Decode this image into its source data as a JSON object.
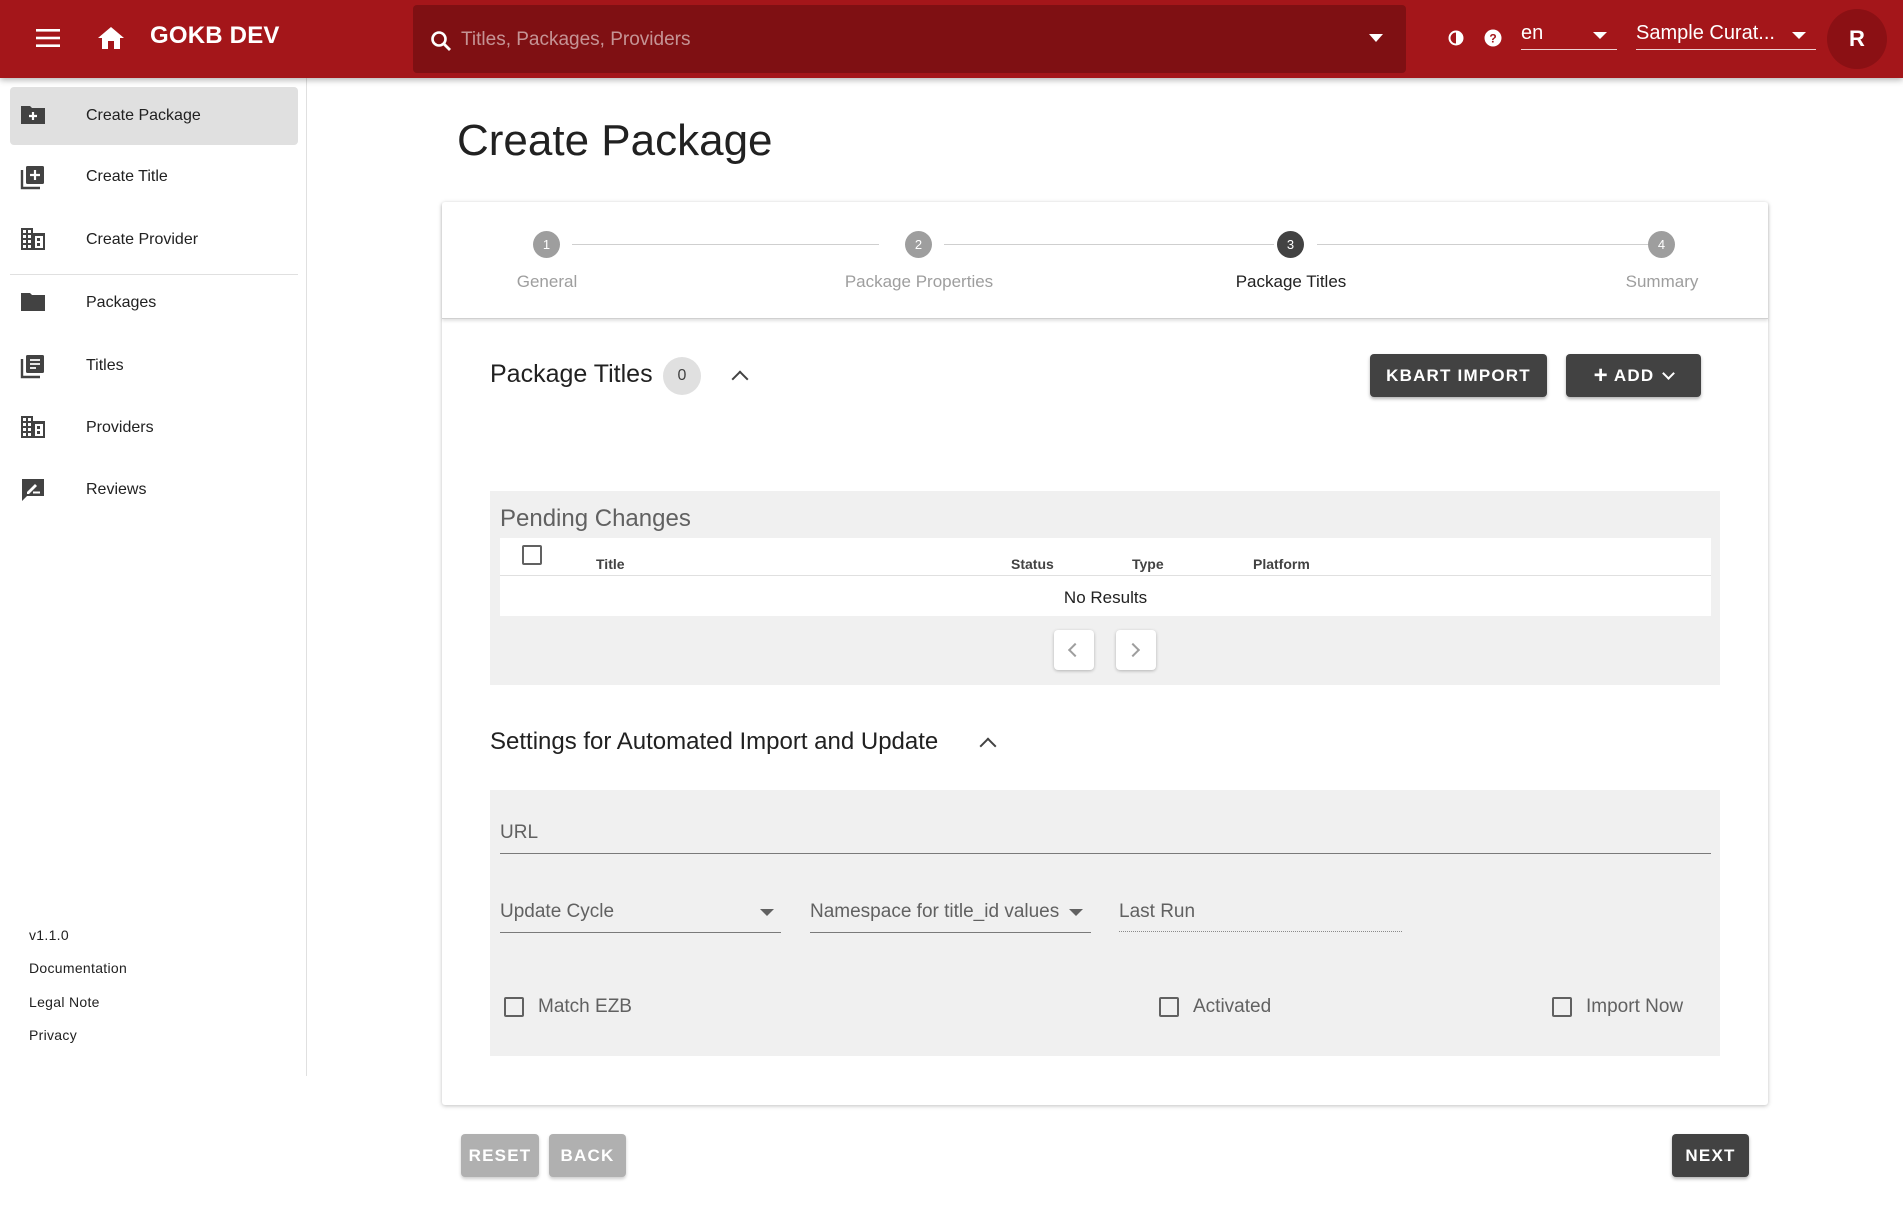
{
  "header": {
    "app_title": "GOKB DEV",
    "search_placeholder": "Titles, Packages, Providers",
    "language": "en",
    "user_menu": "Sample Curat...",
    "avatar_initial": "R",
    "color": "#a4161a"
  },
  "sidebar": {
    "items": [
      {
        "label": "Create Package",
        "icon": "folder-plus-icon"
      },
      {
        "label": "Create Title",
        "icon": "library-add-icon"
      },
      {
        "label": "Create Provider",
        "icon": "domain-icon"
      },
      {
        "label": "Packages",
        "icon": "folder-icon"
      },
      {
        "label": "Titles",
        "icon": "library-books-icon"
      },
      {
        "label": "Providers",
        "icon": "domain-icon"
      },
      {
        "label": "Reviews",
        "icon": "rate-review-icon"
      }
    ],
    "footer": {
      "version": "v1.1.0",
      "documentation": "Documentation",
      "legal": "Legal Note",
      "privacy": "Privacy"
    }
  },
  "main": {
    "page_title": "Create Package",
    "steps": [
      {
        "number": "1",
        "label": "General"
      },
      {
        "number": "2",
        "label": "Package Properties"
      },
      {
        "number": "3",
        "label": "Package Titles"
      },
      {
        "number": "4",
        "label": "Summary"
      }
    ],
    "package_titles": {
      "title": "Package Titles",
      "count": "0",
      "kbart_import": "KBART IMPORT",
      "add": "ADD"
    },
    "pending": {
      "title": "Pending Changes",
      "columns": [
        "Title",
        "Status",
        "Type",
        "Platform"
      ],
      "empty": "No Results"
    },
    "settings": {
      "title": "Settings for Automated Import and Update",
      "url_label": "URL",
      "update_cycle": "Update Cycle",
      "namespace": "Namespace for title_id values",
      "last_run": "Last Run",
      "match_ezb": "Match EZB",
      "activated": "Activated",
      "import_now": "Import Now"
    },
    "actions": {
      "reset": "RESET",
      "back": "BACK",
      "next": "NEXT"
    }
  }
}
